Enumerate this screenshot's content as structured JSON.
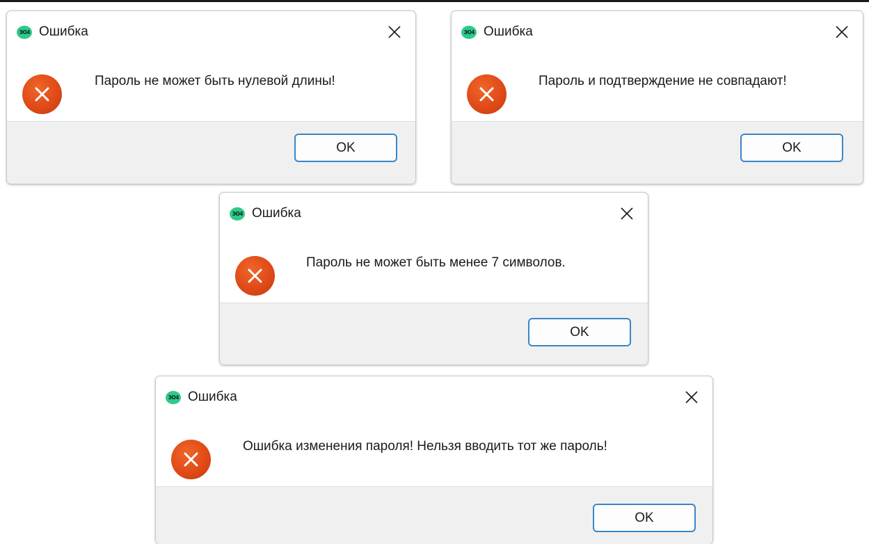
{
  "colors": {
    "app_icon": "#2fc98a",
    "error_icon": "#e04a17",
    "ok_border": "#3a86c8",
    "footer_bg": "#f0f0f0"
  },
  "dialogs": [
    {
      "app_icon_text": "ЭО4",
      "title": "Ошибка",
      "icon": "error-icon",
      "message": "Пароль не может быть нулевой длины!",
      "ok_label": "OK"
    },
    {
      "app_icon_text": "ЭО4",
      "title": "Ошибка",
      "icon": "error-icon",
      "message": "Пароль и подтверждение не совпадают!",
      "ok_label": "OK"
    },
    {
      "app_icon_text": "ЭО4",
      "title": "Ошибка",
      "icon": "error-icon",
      "message": "Пароль не может быть менее 7 символов.",
      "ok_label": "OK"
    },
    {
      "app_icon_text": "ЭО4",
      "title": "Ошибка",
      "icon": "error-icon",
      "message": "Ошибка изменения пароля! Нельзя вводить тот же пароль!",
      "ok_label": "OK"
    }
  ]
}
